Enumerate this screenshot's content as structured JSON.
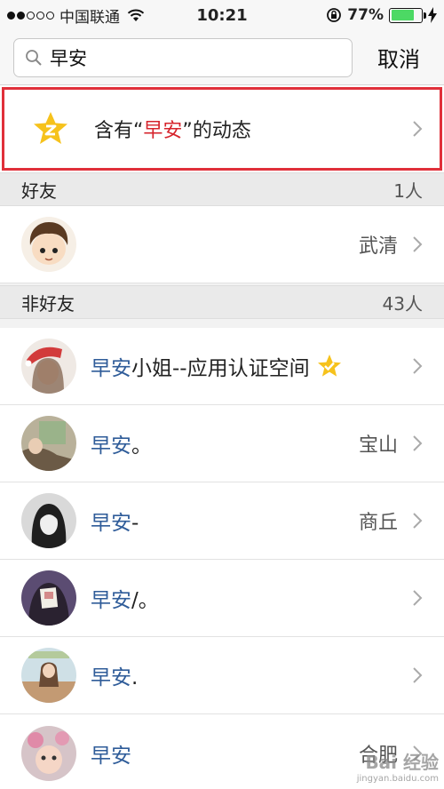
{
  "status_bar": {
    "carrier": "中国联通",
    "time": "10:21",
    "battery": "77%",
    "battery_level": 0.77
  },
  "search": {
    "query": "早安",
    "cancel": "取消"
  },
  "moments": {
    "prefix": "含有“",
    "keyword": "早安",
    "suffix": "”的动态"
  },
  "friends_section": {
    "title": "好友",
    "count": "1人",
    "items": [
      {
        "name": "",
        "location": "武清"
      }
    ]
  },
  "nonfriends_section": {
    "title": "非好友",
    "count": "43人",
    "items": [
      {
        "highlight": "早安",
        "rest": "小姐--应用认证空间",
        "location": "",
        "verified": true
      },
      {
        "highlight": "早安",
        "rest": "。",
        "location": "宝山"
      },
      {
        "highlight": "早安",
        "rest": "-",
        "location": "商丘"
      },
      {
        "highlight": "早安",
        "rest": "/。",
        "location": ""
      },
      {
        "highlight": "早安",
        "rest": ".",
        "location": ""
      },
      {
        "highlight": "早安",
        "rest": "",
        "location": "合肥"
      }
    ]
  },
  "watermark": {
    "line1": "Bai 经验",
    "line2": "jingyan.baidu.com"
  },
  "colors": {
    "highlight_name": "#2f5c99",
    "keyword_red": "#d6242c",
    "frame_red": "#e0303a",
    "battery_green": "#4cd964"
  }
}
